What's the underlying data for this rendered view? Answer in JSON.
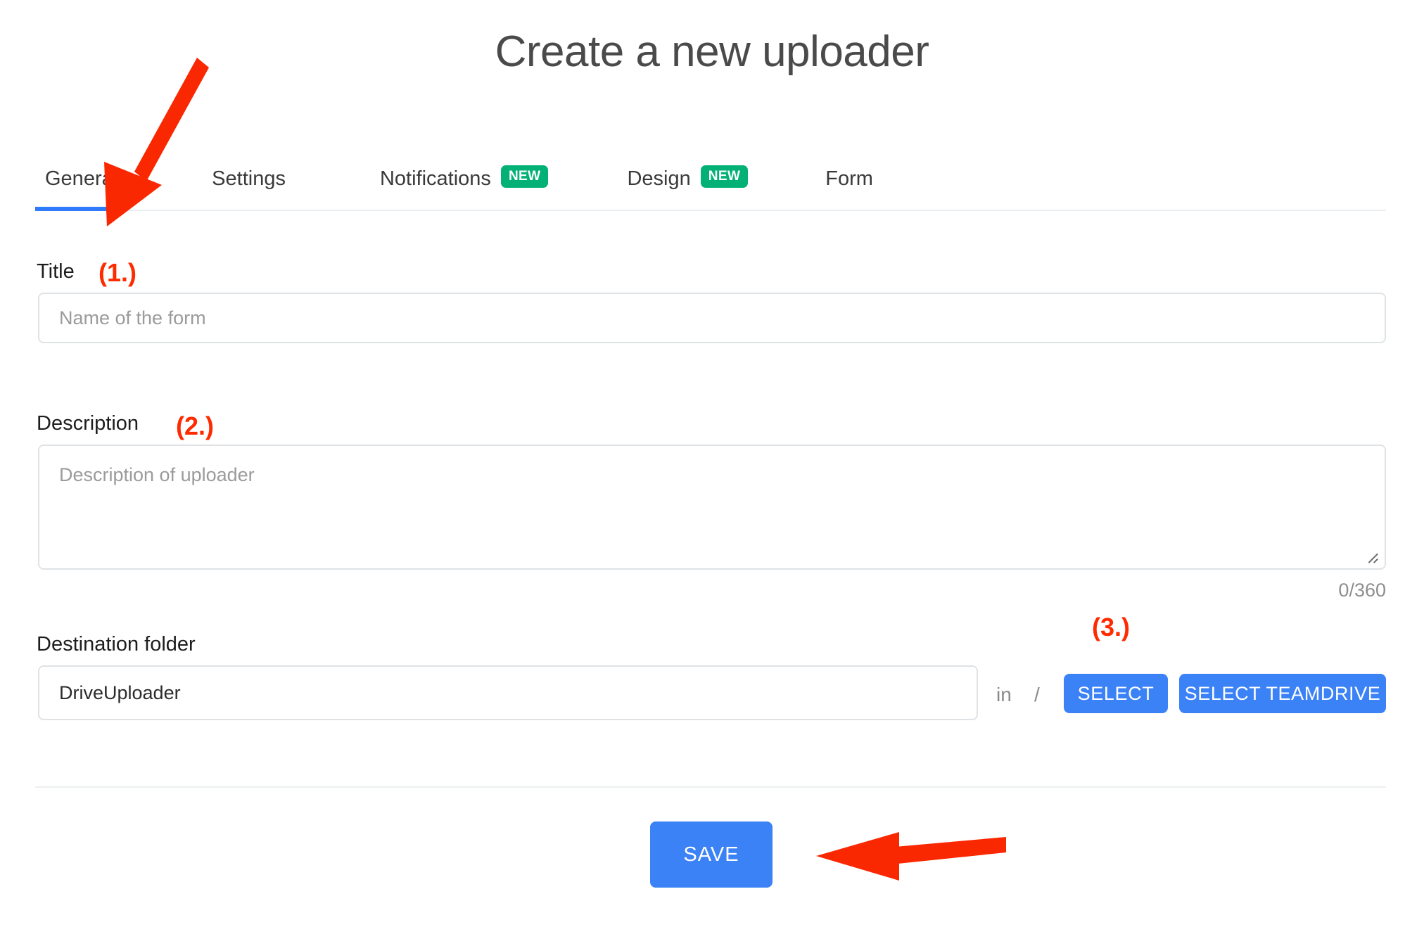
{
  "header": {
    "title": "Create a new uploader"
  },
  "tabs": [
    {
      "label": "General",
      "badge": null,
      "active": true
    },
    {
      "label": "Settings",
      "badge": null,
      "active": false
    },
    {
      "label": "Notifications",
      "badge": "NEW",
      "active": false
    },
    {
      "label": "Design",
      "badge": "NEW",
      "active": false
    },
    {
      "label": "Form",
      "badge": null,
      "active": false
    }
  ],
  "form": {
    "title_field": {
      "label": "Title",
      "placeholder": "Name of the form",
      "value": ""
    },
    "description_field": {
      "label": "Description",
      "placeholder": "Description of uploader",
      "value": "",
      "counter": "0/360"
    },
    "destination_field": {
      "label": "Destination folder",
      "value": "DriveUploader",
      "in_text": "in",
      "path_text": "/",
      "select_label": "SELECT",
      "select_teamdrive_label": "SELECT TEAMDRIVE"
    },
    "save_label": "SAVE"
  },
  "annotations": [
    {
      "text": "(1.)"
    },
    {
      "text": "(2.)"
    },
    {
      "text": "(3.)"
    }
  ],
  "colors": {
    "accent_blue": "#3b82f6",
    "tab_underline": "#2f7bfb",
    "badge_green": "#03b176",
    "annotation_red": "#ff2a00",
    "border_grey": "#dfe3e6",
    "placeholder_grey": "#9b9b9b"
  }
}
